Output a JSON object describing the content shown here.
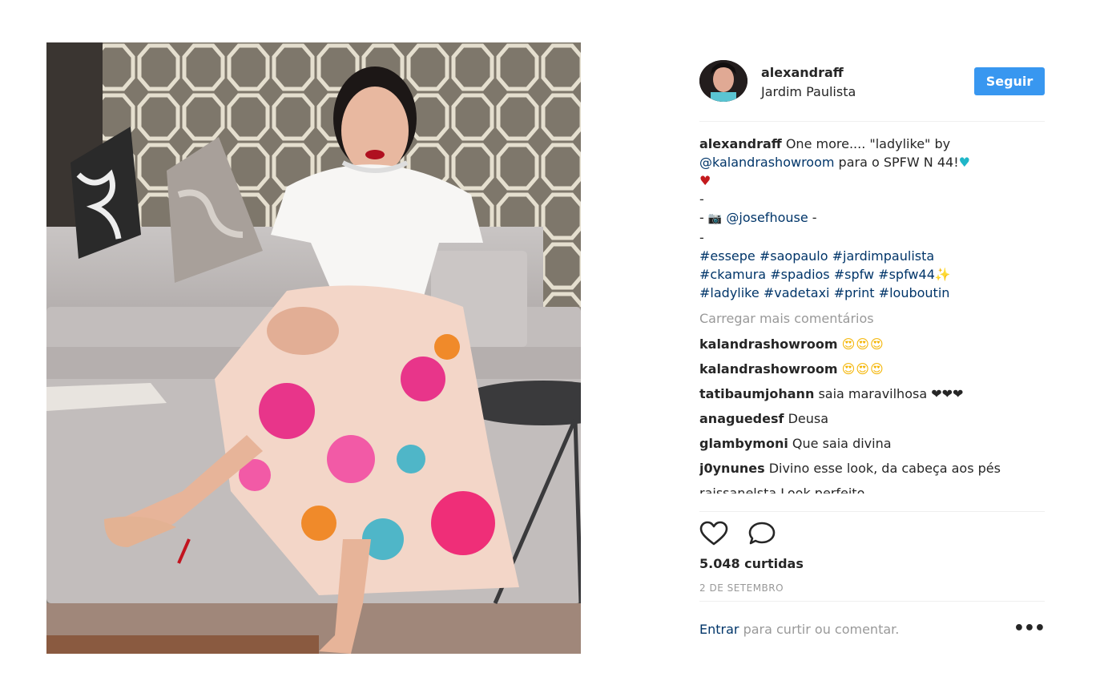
{
  "post": {
    "username": "alexandraff",
    "location": "Jardim Paulista",
    "follow_label": "Seguir",
    "caption": {
      "author": "alexandraff",
      "text1": " One more.... \"ladylike\" by ",
      "mention1": "@kalandrashowroom",
      "text2": " para o SPFW N 44!",
      "dash": "-",
      "photo_dash_open": "- ",
      "mention2": "@josefhouse",
      "photo_dash_close": " -",
      "hashtags_line1": [
        "#essepe",
        "#saopaulo",
        "#jardimpaulista"
      ],
      "hashtags_line2": [
        "#ckamura",
        "#spadios",
        "#spfw",
        "#spfw44"
      ],
      "hashtags_line3": [
        "#ladylike",
        "#vadetaxi",
        "#print",
        "#louboutin"
      ]
    },
    "load_more_label": "Carregar mais comentários",
    "comments": [
      {
        "user": "kalandrashowroom",
        "text": "😍😍😍"
      },
      {
        "user": "kalandrashowroom",
        "text": "😍😍😍"
      },
      {
        "user": "tatibaumjohann",
        "text": "saia maravilhosa ❤❤❤"
      },
      {
        "user": "anaguedesf",
        "text": "Deusa"
      },
      {
        "user": "glambymoni",
        "text": "Que saia divina"
      },
      {
        "user": "j0ynunes",
        "text": "Divino esse look, da cabeça aos pés"
      }
    ],
    "partial_comment": "raissanelsta Look perfeito",
    "likes": "5.048 curtidas",
    "date": "2 DE SETEMBRO",
    "footer": {
      "enter_label": "Entrar",
      "rest": " para curtir ou comentar.",
      "more_label": "•••"
    }
  },
  "icons": {
    "like": "heart-outline",
    "comment": "speech-bubble",
    "camera": "camera-emoji"
  },
  "colors": {
    "follow_button": "#3897f0",
    "link": "#003569",
    "muted": "#999999",
    "divider": "#efefef"
  }
}
